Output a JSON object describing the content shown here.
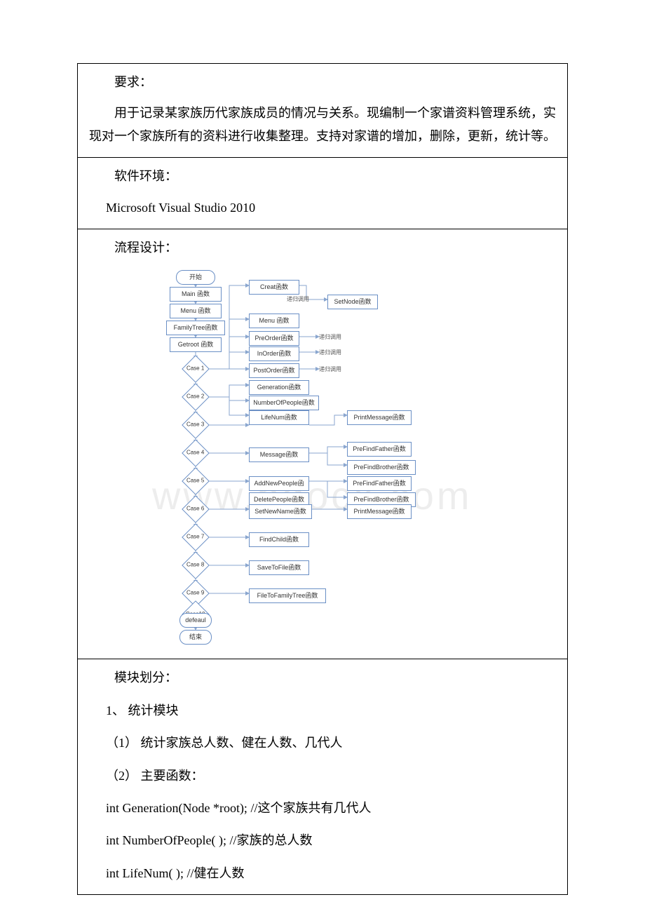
{
  "requirements": {
    "heading": "要求：",
    "body": "用于记录某家族历代家族成员的情况与关系。现编制一个家谱资料管理系统，实现对一个家族所有的资料进行收集整理。支持对家谱的增加，删除，更新，统计等。"
  },
  "environment": {
    "heading": "软件环境：",
    "body": "Microsoft Visual Studio 2010"
  },
  "flow": {
    "heading": "流程设计：",
    "nodes": {
      "start": "开始",
      "main": "Main 函数",
      "menu1": "Menu 函数",
      "familytree": "FamilyTree函数",
      "getroot": "Getroot 函数",
      "case1": "Case 1",
      "case2": "Case 2",
      "case3": "Case 3",
      "case4": "Case 4",
      "case5": "Case 5",
      "case6": "Case 6",
      "case7": "Case 7",
      "case8": "Case 8",
      "case9": "Case 9",
      "case10": "Case10",
      "default": "defeaul",
      "end": "结束",
      "creat": "Creat函数",
      "setnode": "SetNode函数",
      "menu2": "Menu 函数",
      "preorder": "PreOrder函数",
      "inorder": "InOrder函数",
      "postorder": "PostOrder函数",
      "generation": "Generation函数",
      "numpeople": "NumberOfPeople函数",
      "lifenum": "LifeNum函数",
      "message": "Message函数",
      "addnew": "AddNewPeople函",
      "deletepeople": "DeletePeople函数",
      "setnewname": "SetNewName函数",
      "findchild": "FindChild函数",
      "savetofile": "SaveToFile函数",
      "filetofamily": "FileToFamilyTree函数",
      "printmsg1": "PrintMessage函数",
      "prefindfather1": "PreFindFather函数",
      "prefindbrother1": "PreFindBrother函数",
      "prefindfather2": "PreFindFather函数",
      "prefindbrother2": "PreFindBrother函数",
      "printmsg2": "PrintMessage函数"
    },
    "labels": {
      "recursive": "递归调用"
    }
  },
  "modules": {
    "heading": "模块划分：",
    "item1_title": "1、 统计模块",
    "item1_1": "（1） 统计家族总人数、健在人数、几代人",
    "item1_2": "（2） 主要函数：",
    "fn1": "int Generation(Node *root); //这个家族共有几代人",
    "fn2": "int NumberOfPeople( ); //家族的总人数",
    "fn3": "int LifeNum( ); //健在人数"
  },
  "watermark": "www.bdocx.com"
}
